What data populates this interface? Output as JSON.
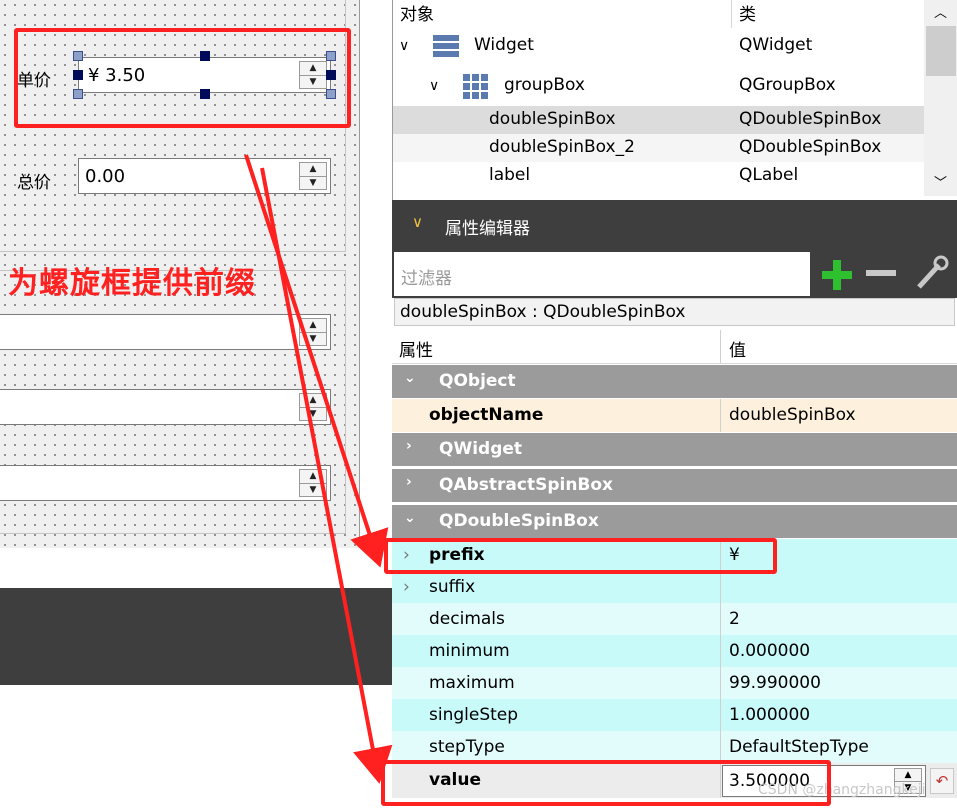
{
  "canvas": {
    "unit_price_label": "单价",
    "unit_price_value": "¥ 3.50",
    "total_price_label": "总价",
    "total_price_value": "0.00"
  },
  "annotation": {
    "text": "为螺旋框提供前缀",
    "color": "#ff2020"
  },
  "object_inspector": {
    "col_object": "对象",
    "col_class": "类",
    "rows": [
      {
        "name": "Widget",
        "cls": "QWidget"
      },
      {
        "name": "groupBox",
        "cls": "QGroupBox"
      },
      {
        "name": "doubleSpinBox",
        "cls": "QDoubleSpinBox"
      },
      {
        "name": "doubleSpinBox_2",
        "cls": "QDoubleSpinBox"
      },
      {
        "name": "label",
        "cls": "QLabel"
      }
    ]
  },
  "property_editor": {
    "title": "属性编辑器",
    "filter_placeholder": "过滤器",
    "object_class": "doubleSpinBox : QDoubleSpinBox",
    "col_property": "属性",
    "col_value": "值",
    "groups": {
      "qobject": "QObject",
      "qwidget": "QWidget",
      "qabstractspinbox": "QAbstractSpinBox",
      "qdoublespinbox": "QDoubleSpinBox"
    },
    "props": {
      "objectName": {
        "k": "objectName",
        "v": "doubleSpinBox"
      },
      "prefix": {
        "k": "prefix",
        "v": "¥"
      },
      "suffix": {
        "k": "suffix",
        "v": ""
      },
      "decimals": {
        "k": "decimals",
        "v": "2"
      },
      "minimum": {
        "k": "minimum",
        "v": "0.000000"
      },
      "maximum": {
        "k": "maximum",
        "v": "99.990000"
      },
      "singleStep": {
        "k": "singleStep",
        "v": "1.000000"
      },
      "stepType": {
        "k": "stepType",
        "v": "DefaultStepType"
      },
      "value": {
        "k": "value",
        "v": "3.500000"
      }
    }
  },
  "watermark": "CSDN @zhangzhangkeji",
  "colors": {
    "highlight_red": "#ff2020",
    "prop_cyan": "#c8fafa",
    "group_grey": "#9b9b9b",
    "dark_panel": "#3e3e3e"
  }
}
